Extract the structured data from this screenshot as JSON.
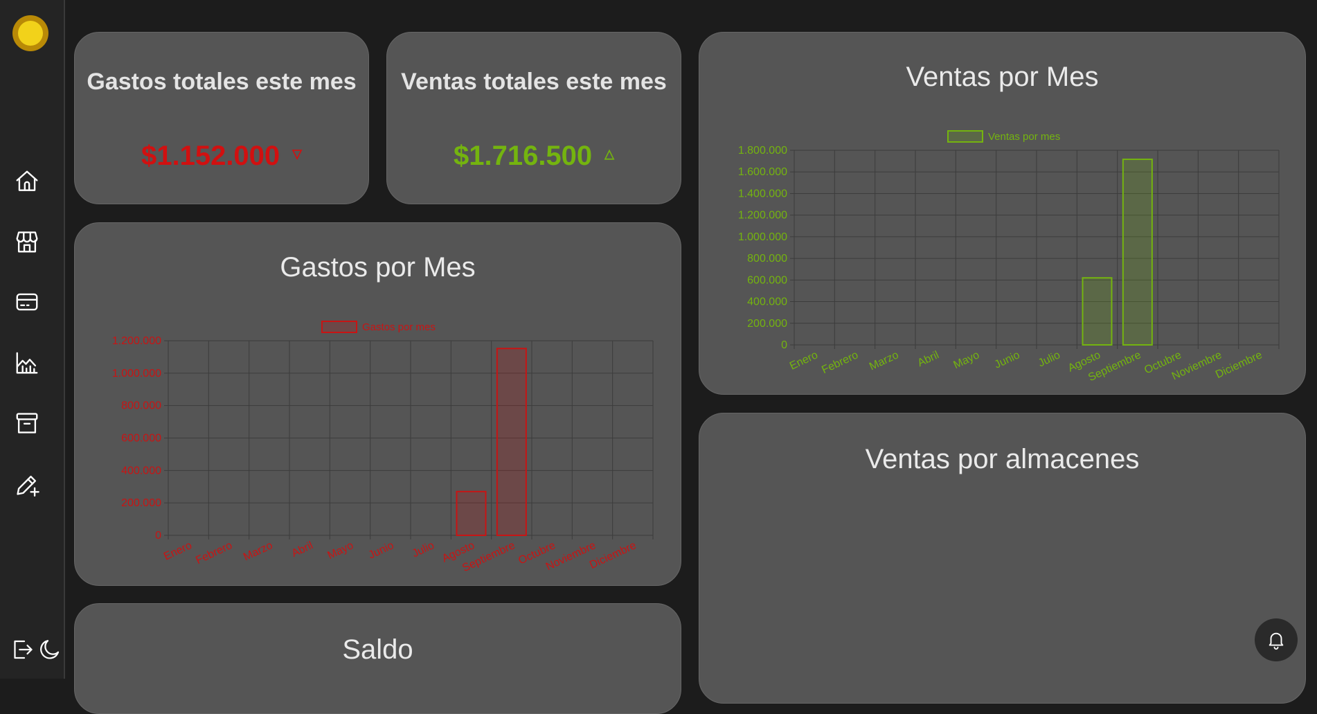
{
  "sidebar": {
    "logo": "sun-logo",
    "items": [
      {
        "name": "home",
        "icon": "home-icon"
      },
      {
        "name": "store",
        "icon": "store-icon"
      },
      {
        "name": "card",
        "icon": "credit-card-icon"
      },
      {
        "name": "analytics",
        "icon": "chart-icon"
      },
      {
        "name": "archive",
        "icon": "archive-icon"
      },
      {
        "name": "edit",
        "icon": "edit-add-icon"
      }
    ],
    "logout_icon": "logout-icon",
    "theme_icon": "moon-icon"
  },
  "kpis": {
    "gastos": {
      "title": "Gastos totales este mes",
      "value": "$1.152.000",
      "trend": "down",
      "color": "#d11010"
    },
    "ventas": {
      "title": "Ventas totales este mes",
      "value": "$1.716.500",
      "trend": "up",
      "color": "#74b40f"
    }
  },
  "cards": {
    "gastos_chart_title": "Gastos por Mes",
    "ventas_chart_title": "Ventas por Mes",
    "almacenes_title": "Ventas por almacenes",
    "saldo_title": "Saldo"
  },
  "chart_data": [
    {
      "type": "bar",
      "title": "Gastos por Mes",
      "categories": [
        "Enero",
        "Febrero",
        "Marzo",
        "Abril",
        "Mayo",
        "Junio",
        "Julio",
        "Agosto",
        "Septiembre",
        "Octubre",
        "Noviembre",
        "Diciembre"
      ],
      "series": [
        {
          "name": "Gastos por mes",
          "values": [
            0,
            0,
            0,
            0,
            0,
            0,
            0,
            270000,
            1152000,
            0,
            0,
            0
          ]
        }
      ],
      "ylim": [
        0,
        1200000
      ],
      "yticks": [
        "0",
        "200.000",
        "400.000",
        "600.000",
        "800.000",
        "1.000.000",
        "1.200.000"
      ],
      "grid": true,
      "legend": "top",
      "color": "#c81414"
    },
    {
      "type": "bar",
      "title": "Ventas por Mes",
      "categories": [
        "Enero",
        "Febrero",
        "Marzo",
        "Abril",
        "Mayo",
        "Junio",
        "Julio",
        "Agosto",
        "Septiembre",
        "Octubre",
        "Noviembre",
        "Diciembre"
      ],
      "series": [
        {
          "name": "Ventas por mes",
          "values": [
            0,
            0,
            0,
            0,
            0,
            0,
            0,
            620000,
            1716500,
            0,
            0,
            0
          ]
        }
      ],
      "ylim": [
        0,
        1800000
      ],
      "yticks": [
        "0",
        "200.000",
        "400.000",
        "600.000",
        "800.000",
        "1.000.000",
        "1.200.000",
        "1.400.000",
        "1.600.000",
        "1.800.000"
      ],
      "grid": true,
      "legend": "top",
      "color": "#74b40f"
    }
  ],
  "notifications": {
    "icon": "bell-icon"
  }
}
